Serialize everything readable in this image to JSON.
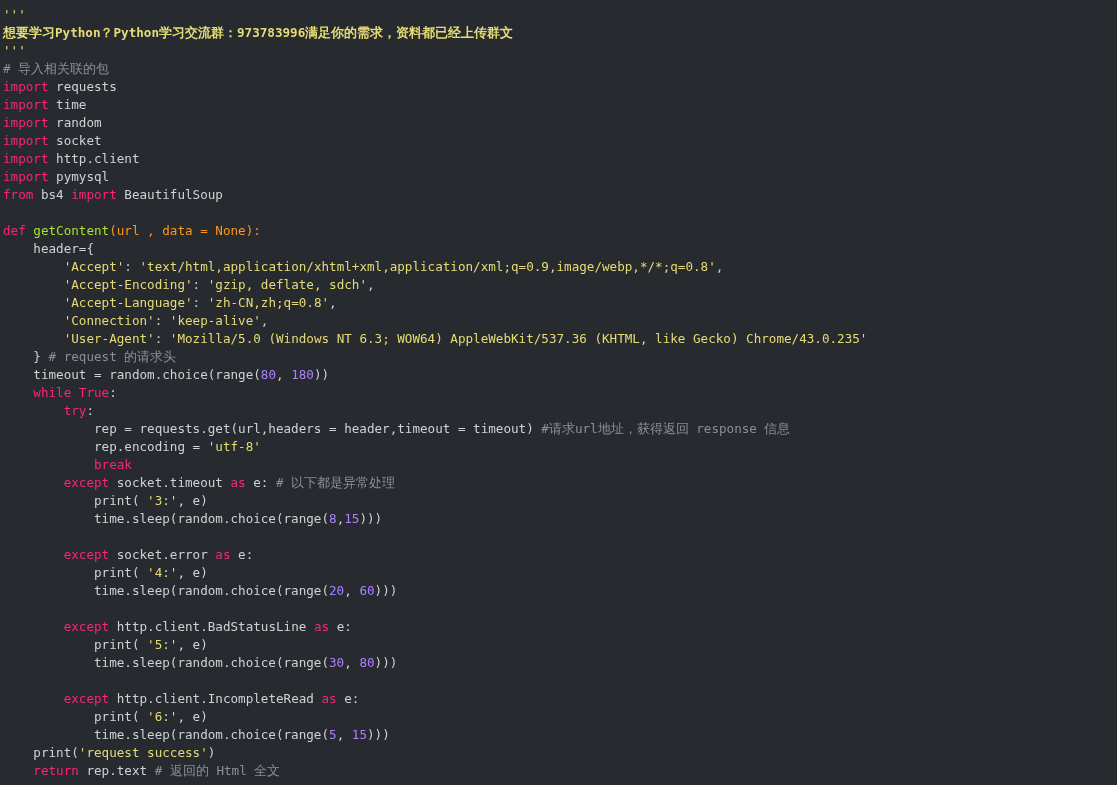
{
  "editor": {
    "lines": [
      {
        "kind": "code",
        "tokens": [
          {
            "kind": "str",
            "text": "'''"
          }
        ]
      },
      {
        "kind": "code",
        "tokens": [
          {
            "kind": "doc",
            "text": "想要学习Python？Python学习交流群：973783996满足你的需求，资料都已经上传群文"
          }
        ]
      },
      {
        "kind": "code",
        "tokens": [
          {
            "kind": "str",
            "text": "'''"
          }
        ]
      },
      {
        "kind": "code",
        "tokens": [
          {
            "kind": "com",
            "text": "# 导入相关联的包"
          }
        ]
      },
      {
        "kind": "code",
        "tokens": [
          {
            "kind": "kw",
            "text": "import"
          },
          {
            "kind": "plain",
            "text": " requests"
          }
        ]
      },
      {
        "kind": "code",
        "tokens": [
          {
            "kind": "kw",
            "text": "import"
          },
          {
            "kind": "plain",
            "text": " time"
          }
        ]
      },
      {
        "kind": "code",
        "tokens": [
          {
            "kind": "kw",
            "text": "import"
          },
          {
            "kind": "plain",
            "text": " random"
          }
        ]
      },
      {
        "kind": "code",
        "tokens": [
          {
            "kind": "kw",
            "text": "import"
          },
          {
            "kind": "plain",
            "text": " socket"
          }
        ]
      },
      {
        "kind": "code",
        "tokens": [
          {
            "kind": "kw",
            "text": "import"
          },
          {
            "kind": "plain",
            "text": " http.client"
          }
        ]
      },
      {
        "kind": "code",
        "tokens": [
          {
            "kind": "kw",
            "text": "import"
          },
          {
            "kind": "plain",
            "text": " pymysql"
          }
        ]
      },
      {
        "kind": "code",
        "tokens": [
          {
            "kind": "kw",
            "text": "from"
          },
          {
            "kind": "plain",
            "text": " bs4 "
          },
          {
            "kind": "kw",
            "text": "import"
          },
          {
            "kind": "plain",
            "text": " BeautifulSoup"
          }
        ]
      },
      {
        "kind": "blank"
      },
      {
        "kind": "code",
        "tokens": [
          {
            "kind": "kw",
            "text": "def "
          },
          {
            "kind": "fn",
            "text": "getContent"
          },
          {
            "kind": "param",
            "text": "(url , data = None):"
          }
        ]
      },
      {
        "kind": "code",
        "tokens": [
          {
            "kind": "plain",
            "text": "    header={"
          }
        ]
      },
      {
        "kind": "code",
        "tokens": [
          {
            "kind": "str",
            "text": "        'Accept'"
          },
          {
            "kind": "plain",
            "text": ": "
          },
          {
            "kind": "str",
            "text": "'text/html,application/xhtml+xml,application/xml;q=0.9,image/webp,*/*;q=0.8'"
          },
          {
            "kind": "plain",
            "text": ","
          }
        ]
      },
      {
        "kind": "code",
        "tokens": [
          {
            "kind": "str",
            "text": "        'Accept-Encoding'"
          },
          {
            "kind": "plain",
            "text": ": "
          },
          {
            "kind": "str",
            "text": "'gzip, deflate, sdch'"
          },
          {
            "kind": "plain",
            "text": ","
          }
        ]
      },
      {
        "kind": "code",
        "tokens": [
          {
            "kind": "str",
            "text": "        'Accept-Language'"
          },
          {
            "kind": "plain",
            "text": ": "
          },
          {
            "kind": "str",
            "text": "'zh-CN,zh;q=0.8'"
          },
          {
            "kind": "plain",
            "text": ","
          }
        ]
      },
      {
        "kind": "code",
        "tokens": [
          {
            "kind": "str",
            "text": "        'Connection'"
          },
          {
            "kind": "plain",
            "text": ": "
          },
          {
            "kind": "str",
            "text": "'keep-alive'"
          },
          {
            "kind": "plain",
            "text": ","
          }
        ]
      },
      {
        "kind": "code",
        "tokens": [
          {
            "kind": "str",
            "text": "        'User-Agent'"
          },
          {
            "kind": "plain",
            "text": ": "
          },
          {
            "kind": "str",
            "text": "'Mozilla/5.0 (Windows NT 6.3; WOW64) AppleWebKit/537.36 (KHTML, like Gecko) Chrome/43.0.235'"
          }
        ]
      },
      {
        "kind": "code",
        "tokens": [
          {
            "kind": "plain",
            "text": "    } "
          },
          {
            "kind": "com",
            "text": "# request 的请求头"
          }
        ]
      },
      {
        "kind": "code",
        "tokens": [
          {
            "kind": "plain",
            "text": "    timeout = random.choice(range("
          },
          {
            "kind": "num",
            "text": "80"
          },
          {
            "kind": "plain",
            "text": ", "
          },
          {
            "kind": "num",
            "text": "180"
          },
          {
            "kind": "plain",
            "text": "))"
          }
        ]
      },
      {
        "kind": "code",
        "tokens": [
          {
            "kind": "kw",
            "text": "    while True"
          },
          {
            "kind": "plain",
            "text": ":"
          }
        ]
      },
      {
        "kind": "code",
        "tokens": [
          {
            "kind": "kw",
            "text": "        try"
          },
          {
            "kind": "plain",
            "text": ":"
          }
        ]
      },
      {
        "kind": "code",
        "tokens": [
          {
            "kind": "plain",
            "text": "            rep = requests.get(url,headers = header,timeout = timeout) "
          },
          {
            "kind": "com",
            "text": "#请求url地址，获得返回 response 信息"
          }
        ]
      },
      {
        "kind": "code",
        "tokens": [
          {
            "kind": "plain",
            "text": "            rep.encoding = "
          },
          {
            "kind": "str",
            "text": "'utf-8'"
          }
        ]
      },
      {
        "kind": "code",
        "tokens": [
          {
            "kind": "kw",
            "text": "            break"
          }
        ]
      },
      {
        "kind": "code",
        "tokens": [
          {
            "kind": "kw",
            "text": "        except"
          },
          {
            "kind": "plain",
            "text": " socket.timeout "
          },
          {
            "kind": "kw",
            "text": "as"
          },
          {
            "kind": "plain",
            "text": " e: "
          },
          {
            "kind": "com",
            "text": "# 以下都是异常处理"
          }
        ]
      },
      {
        "kind": "code",
        "tokens": [
          {
            "kind": "plain",
            "text": "            print( "
          },
          {
            "kind": "str",
            "text": "'3:'"
          },
          {
            "kind": "plain",
            "text": ", e)"
          }
        ]
      },
      {
        "kind": "code",
        "tokens": [
          {
            "kind": "plain",
            "text": "            time.sleep(random.choice(range("
          },
          {
            "kind": "num",
            "text": "8"
          },
          {
            "kind": "plain",
            "text": ","
          },
          {
            "kind": "num",
            "text": "15"
          },
          {
            "kind": "plain",
            "text": ")))"
          }
        ]
      },
      {
        "kind": "blank"
      },
      {
        "kind": "code",
        "tokens": [
          {
            "kind": "kw",
            "text": "        except"
          },
          {
            "kind": "plain",
            "text": " socket.error "
          },
          {
            "kind": "kw",
            "text": "as"
          },
          {
            "kind": "plain",
            "text": " e:"
          }
        ]
      },
      {
        "kind": "code",
        "tokens": [
          {
            "kind": "plain",
            "text": "            print( "
          },
          {
            "kind": "str",
            "text": "'4:'"
          },
          {
            "kind": "plain",
            "text": ", e)"
          }
        ]
      },
      {
        "kind": "code",
        "tokens": [
          {
            "kind": "plain",
            "text": "            time.sleep(random.choice(range("
          },
          {
            "kind": "num",
            "text": "20"
          },
          {
            "kind": "plain",
            "text": ", "
          },
          {
            "kind": "num",
            "text": "60"
          },
          {
            "kind": "plain",
            "text": ")))"
          }
        ]
      },
      {
        "kind": "blank"
      },
      {
        "kind": "code",
        "tokens": [
          {
            "kind": "kw",
            "text": "        except"
          },
          {
            "kind": "plain",
            "text": " http.client.BadStatusLine "
          },
          {
            "kind": "kw",
            "text": "as"
          },
          {
            "kind": "plain",
            "text": " e:"
          }
        ]
      },
      {
        "kind": "code",
        "tokens": [
          {
            "kind": "plain",
            "text": "            print( "
          },
          {
            "kind": "str",
            "text": "'5:'"
          },
          {
            "kind": "plain",
            "text": ", e)"
          }
        ]
      },
      {
        "kind": "code",
        "tokens": [
          {
            "kind": "plain",
            "text": "            time.sleep(random.choice(range("
          },
          {
            "kind": "num",
            "text": "30"
          },
          {
            "kind": "plain",
            "text": ", "
          },
          {
            "kind": "num",
            "text": "80"
          },
          {
            "kind": "plain",
            "text": ")))"
          }
        ]
      },
      {
        "kind": "blank"
      },
      {
        "kind": "code",
        "tokens": [
          {
            "kind": "kw",
            "text": "        except"
          },
          {
            "kind": "plain",
            "text": " http.client.IncompleteRead "
          },
          {
            "kind": "kw",
            "text": "as"
          },
          {
            "kind": "plain",
            "text": " e:"
          }
        ]
      },
      {
        "kind": "code",
        "tokens": [
          {
            "kind": "plain",
            "text": "            print( "
          },
          {
            "kind": "str",
            "text": "'6:'"
          },
          {
            "kind": "plain",
            "text": ", e)"
          }
        ]
      },
      {
        "kind": "code",
        "tokens": [
          {
            "kind": "plain",
            "text": "            time.sleep(random.choice(range("
          },
          {
            "kind": "num",
            "text": "5"
          },
          {
            "kind": "plain",
            "text": ", "
          },
          {
            "kind": "num",
            "text": "15"
          },
          {
            "kind": "plain",
            "text": ")))"
          }
        ]
      },
      {
        "kind": "code",
        "tokens": [
          {
            "kind": "plain",
            "text": "    print("
          },
          {
            "kind": "str",
            "text": "'request success'"
          },
          {
            "kind": "plain",
            "text": ")"
          }
        ]
      },
      {
        "kind": "code",
        "tokens": [
          {
            "kind": "kw",
            "text": "    return"
          },
          {
            "kind": "plain",
            "text": " rep.text "
          },
          {
            "kind": "com",
            "text": "# 返回的 Html 全文"
          }
        ]
      }
    ]
  }
}
